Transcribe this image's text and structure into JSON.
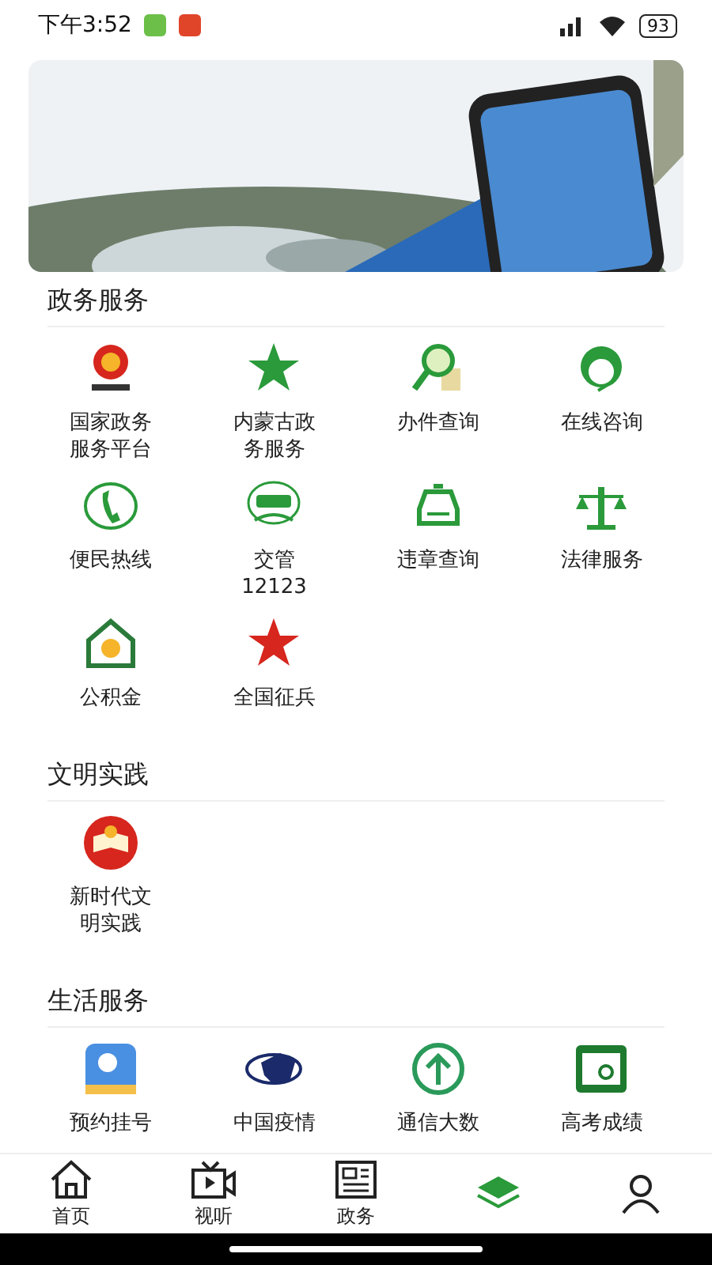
{
  "status_bar": {
    "time": "下午3:52",
    "battery": "93"
  },
  "sections": [
    {
      "title": "政务服务",
      "items": [
        {
          "label": "国家政务服务平台"
        },
        {
          "label": "内蒙古政务服务"
        },
        {
          "label": "办件查询"
        },
        {
          "label": "在线咨询"
        },
        {
          "label": "便民热线"
        },
        {
          "label": "交管 12123"
        },
        {
          "label": "违章查询"
        },
        {
          "label": "法律服务"
        },
        {
          "label": "公积金"
        },
        {
          "label": "全国征兵"
        }
      ]
    },
    {
      "title": "文明实践",
      "items": [
        {
          "label": "新时代文明实践"
        }
      ]
    },
    {
      "title": "生活服务",
      "items": [
        {
          "label": "预约挂号"
        },
        {
          "label": "中国疫情"
        },
        {
          "label": "通信大数"
        },
        {
          "label": "高考成绩"
        }
      ]
    }
  ],
  "tab_bar": [
    {
      "label": "首页"
    },
    {
      "label": "视听"
    },
    {
      "label": "政务"
    }
  ]
}
